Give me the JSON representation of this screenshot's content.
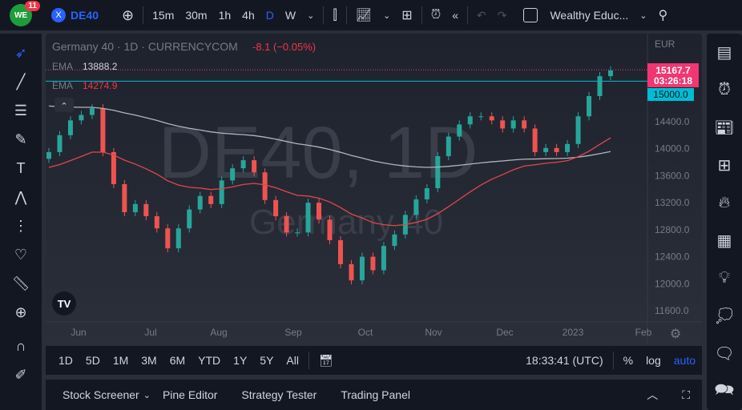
{
  "topbar": {
    "badge": "11",
    "symbol": "DE40",
    "timeframes": [
      "15m",
      "30m",
      "1h",
      "4h",
      "D",
      "W"
    ],
    "active_tf": "D",
    "layout_name": "Wealthy Educ..."
  },
  "legend": {
    "title": "Germany 40 · 1D · CURRENCYCOM",
    "change": "-8.1 (−0.05%)",
    "ema1_label": "EMA",
    "ema1_value": "13888.2",
    "ema2_label": "EMA",
    "ema2_value": "14274.9"
  },
  "watermark": {
    "big": "DE40, 1D",
    "small": "Germany 40"
  },
  "price_axis": {
    "currency": "EUR",
    "last_price": "15167.7",
    "countdown": "03:26:18",
    "line_label": "15000.0"
  },
  "timebar": {
    "ranges": [
      "1D",
      "5D",
      "1M",
      "3M",
      "6M",
      "YTD",
      "1Y",
      "5Y",
      "All"
    ],
    "clock": "18:33:41 (UTC)",
    "pct": "%",
    "log": "log",
    "auto": "auto"
  },
  "bottom": {
    "tabs": [
      "Stock Screener",
      "Pine Editor",
      "Strategy Tester",
      "Trading Panel"
    ]
  },
  "colors": {
    "up": "#26a69a",
    "down": "#ef5350",
    "cyan": "#00bcd4",
    "last": "#f23671",
    "ema_long": "#b2b5be",
    "ema_short": "#e0474c"
  },
  "chart_data": {
    "type": "candlestick",
    "ylim": [
      11400,
      15450
    ],
    "yticks": [
      14400,
      14000,
      13600,
      13200,
      12800,
      12400,
      12000,
      11600
    ],
    "ytick_labels": [
      "14400.0",
      "14000.0",
      "13600.0",
      "13200.0",
      "12800.0",
      "12400.0",
      "12000.0",
      "11600.0"
    ],
    "xticks": [
      "Jun",
      "Jul",
      "Aug",
      "Sep",
      "Oct",
      "Nov",
      "Dec",
      "2023",
      "Feb"
    ],
    "closes": [
      13950,
      14200,
      14420,
      14500,
      14600,
      13950,
      13475,
      13060,
      13180,
      13000,
      12820,
      12525,
      12820,
      13100,
      13300,
      13180,
      13530,
      13710,
      13830,
      13650,
      13240,
      13000,
      12760,
      12760,
      13200,
      12950,
      12645,
      12290,
      12050,
      12400,
      12200,
      12560,
      12730,
      13020,
      13250,
      13415,
      13890,
      14180,
      14360,
      14480,
      14480,
      14420,
      14300,
      14420,
      14300,
      13950,
      14010,
      13950,
      14070,
      14480,
      14780,
      15075,
      15160
    ],
    "open_first": 13850,
    "ema_short_seed": 13700,
    "ema_short_alpha": 0.09,
    "ema_long_seed": 14650,
    "ema_long_alpha": 0.025,
    "hline": 15000,
    "last": 15167.7
  }
}
